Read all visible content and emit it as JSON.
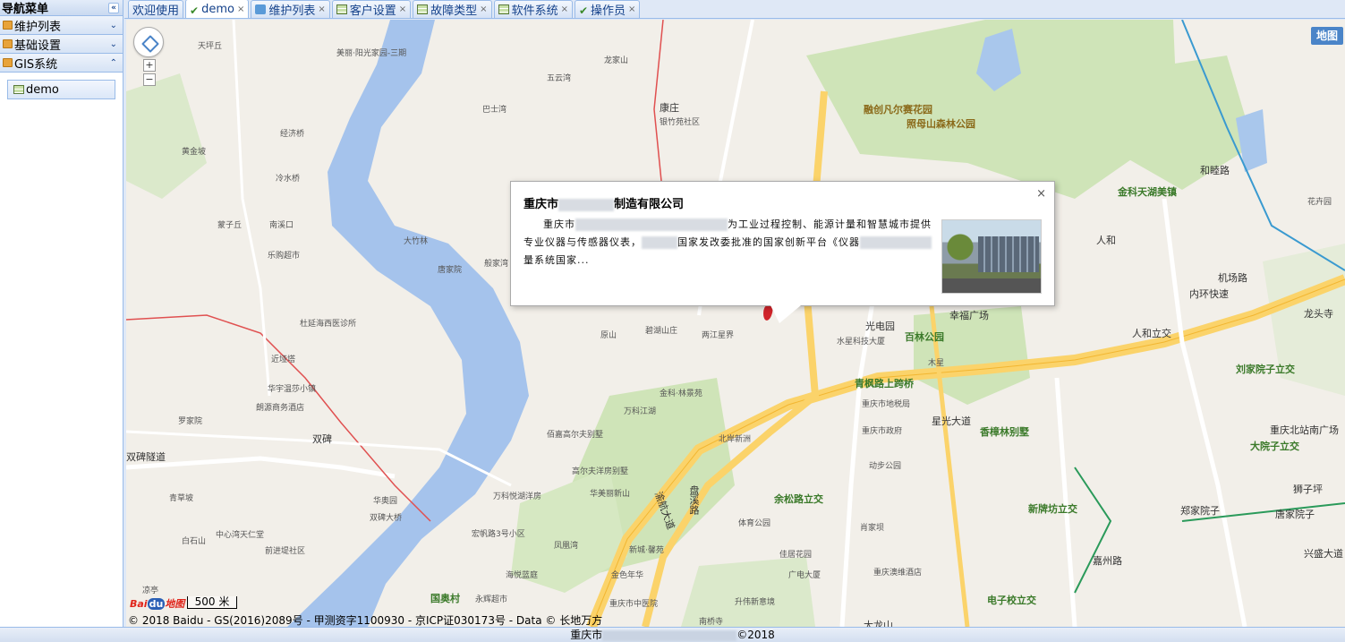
{
  "sidebar": {
    "title": "导航菜单",
    "collapse_icon": "«",
    "sections": [
      {
        "label": "维护列表",
        "chevron": "⌄"
      },
      {
        "label": "基础设置",
        "chevron": "⌄"
      },
      {
        "label": "GIS系统",
        "chevron": "⌃"
      }
    ],
    "items": [
      {
        "label": "demo"
      }
    ]
  },
  "tabs": [
    {
      "label": "欢迎使用",
      "icon": "none",
      "closable": false
    },
    {
      "label": "demo",
      "icon": "check-icon",
      "closable": true,
      "active": true
    },
    {
      "label": "维护列表",
      "icon": "puzzle-icon",
      "closable": true
    },
    {
      "label": "客户设置",
      "icon": "grid-icon",
      "closable": true
    },
    {
      "label": "故障类型",
      "icon": "grid-icon",
      "closable": true
    },
    {
      "label": "软件系统",
      "icon": "grid-icon",
      "closable": true
    },
    {
      "label": "操作员",
      "icon": "check-icon",
      "closable": true
    }
  ],
  "map": {
    "map_type_label": "地图",
    "scale_label": "500 米",
    "logo_text": "Bai",
    "logo_du": "du",
    "logo_suffix": "地图",
    "copyright": "© 2018 Baidu - GS(2016)2089号 - 甲测资字1100930 - 京ICP证030173号 - Data © 长地万方",
    "zoom_in": "+",
    "zoom_out": "−",
    "labels": {
      "l1": "天坪丘",
      "l2": "美丽·阳光家园-三期",
      "l3": "黄金坡",
      "l4": "经济桥",
      "l5": "冷水桥",
      "l6": "南溪口",
      "l7": "蒙子丘",
      "l8": "乐购超市",
      "l9": "杜延海西医诊所",
      "l10": "近垭塔",
      "l11": "华宇温莎小镇",
      "l12": "朗源商务酒店",
      "l13": "罗家院",
      "l14": "双碑",
      "l15": "双碑隧道",
      "l16": "青草坡",
      "l17": "白石山",
      "l18": "前进堤社区",
      "l19": "中心湾天仁堂",
      "l20": "凉亭",
      "l21": "华奥园",
      "l22": "双碑大桥",
      "l23": "巴士湾",
      "l24": "五云湾",
      "l25": "龙家山",
      "l26": "康庄",
      "l27": "银竹苑社区",
      "l28": "大竹林",
      "l29": "唐家院",
      "l30": "般家湾",
      "l31": "原山",
      "l32": "碧湖山庄",
      "l33": "两江星界",
      "l34": "金科·林景苑",
      "l35": "万科江湖",
      "l36": "佰嘉高尔夫别墅",
      "l37": "高尔夫洋房别墅",
      "l38": "华美丽新山",
      "l39": "万科悦湖洋房",
      "l40": "宏帆路3号小区",
      "l41": "凤凰湾",
      "l42": "海悦蓝庭",
      "l43": "国奥村",
      "l44": "永辉超市",
      "l45": "金色年华",
      "l46": "重庆市中医院",
      "l47": "升伟新意境",
      "l48": "南桥寺",
      "l49": "体育公园",
      "l50": "北岸新洲",
      "l51": "余松路立交",
      "l52": "动步公园",
      "l53": "重庆市地税局",
      "l54": "肖家坝",
      "l55": "重庆澳维酒店",
      "l56": "广电大厦",
      "l57": "佳居花园",
      "l58": "新城·馨苑",
      "l59": "光电园",
      "l60": "百林公园",
      "l61": "水星科技大厦",
      "l62": "木星",
      "l63": "青枫路上跨桥",
      "l64": "幸福广场",
      "l65": "重庆市政府",
      "l66": "香樟林别墅",
      "l67": "星光大道",
      "l68": "新牌坊立交",
      "l69": "电子校立交",
      "l70": "金科天湖美镇",
      "l71": "人和",
      "l72": "机场路",
      "l73": "内环快速",
      "l74": "人和立交",
      "l75": "刘家院子立交",
      "l76": "重庆北站南广场",
      "l77": "大院子立交",
      "l78": "狮子坪",
      "l79": "唐家院子",
      "l80": "郑家院子",
      "l81": "嘉州路",
      "l82": "兴盛大道",
      "l83": "融创凡尔赛花园",
      "l84": "照母山森林公园",
      "l85": "和睦路",
      "l86": "花卉园",
      "l87": "大龙山",
      "l88": "龙头寺",
      "l89": "渝航大道",
      "l90": "盘溪路"
    }
  },
  "popup": {
    "title_prefix": "重庆市",
    "title_suffix": "制造有限公司",
    "close": "×",
    "desc_1": "重庆市",
    "desc_2": "为工业过程控制、能源计量和智慧城市提供专业仪器与传感器仪表，",
    "desc_3": "国家发改委批准的国家创新平台《仪器",
    "desc_4": "量系统国家..."
  },
  "footer": {
    "prefix": "重庆市",
    "suffix": "©2018"
  }
}
